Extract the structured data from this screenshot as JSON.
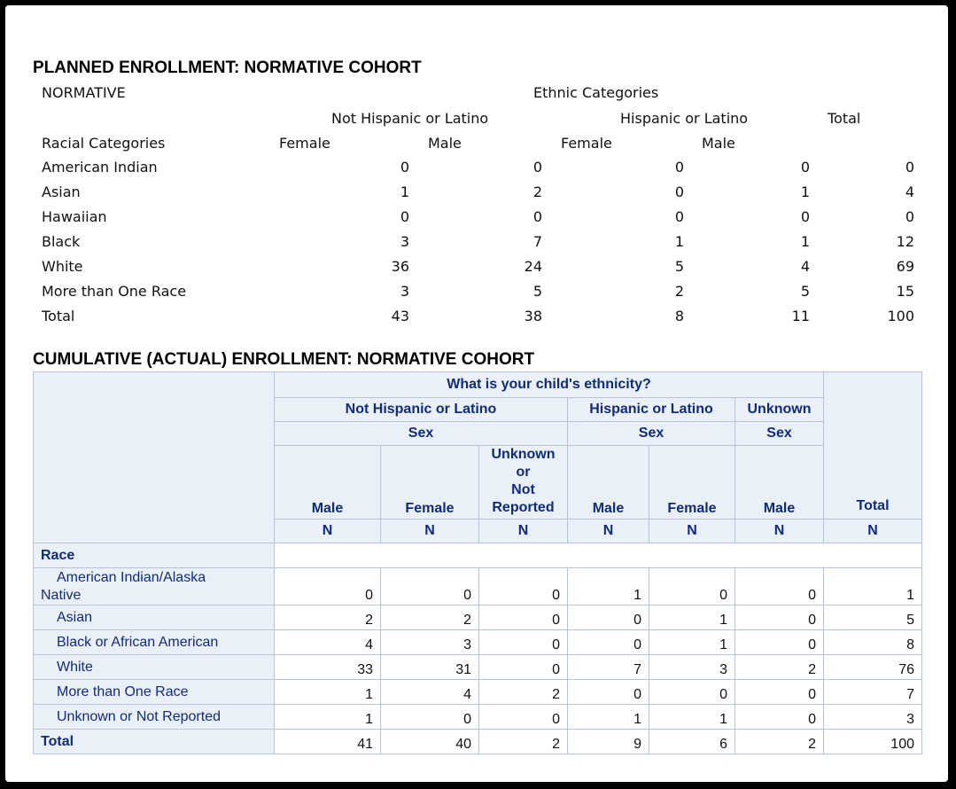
{
  "planned": {
    "title": "PLANNED ENROLLMENT: NORMATIVE COHORT",
    "label_normative": "NORMATIVE",
    "label_ethnic": "Ethnic Categories",
    "label_not_hispanic": "Not Hispanic or Latino",
    "label_hispanic": "Hispanic or Latino",
    "label_total": "Total",
    "label_racial": "Racial Categories",
    "label_female_1": "Female",
    "label_male_1": "Male",
    "label_female_2": "Female",
    "label_male_2": "Male",
    "rows": [
      {
        "label": "American Indian",
        "v": [
          "0",
          "0",
          "0",
          "0",
          "0"
        ]
      },
      {
        "label": "Asian",
        "v": [
          "1",
          "2",
          "0",
          "1",
          "4"
        ]
      },
      {
        "label": "Hawaiian",
        "v": [
          "0",
          "0",
          "0",
          "0",
          "0"
        ]
      },
      {
        "label": "Black",
        "v": [
          "3",
          "7",
          "1",
          "1",
          "12"
        ]
      },
      {
        "label": "White",
        "v": [
          "36",
          "24",
          "5",
          "4",
          "69"
        ]
      },
      {
        "label": "More than One Race",
        "v": [
          "3",
          "5",
          "2",
          "5",
          "15"
        ]
      },
      {
        "label": "Total",
        "v": [
          "43",
          "38",
          "8",
          "11",
          "100"
        ]
      }
    ]
  },
  "actual": {
    "title": "CUMULATIVE (ACTUAL) ENROLLMENT: NORMATIVE COHORT",
    "question": "What is your child's ethnicity?",
    "not_hispanic": "Not Hispanic or Latino",
    "hispanic": "Hispanic or Latino",
    "unknown": "Unknown",
    "sex": "Sex",
    "male": "Male",
    "female": "Female",
    "unknown_sex_l1": "Unknown",
    "unknown_sex_l2": "or",
    "unknown_sex_l3": "Not",
    "unknown_sex_l4": "Reported",
    "total": "Total",
    "n": "N",
    "race": "Race",
    "rows": [
      {
        "label_l1": "American Indian/Alaska",
        "label_l2": "Native",
        "v": [
          "0",
          "0",
          "0",
          "1",
          "0",
          "0",
          "1"
        ]
      },
      {
        "label": "Asian",
        "v": [
          "2",
          "2",
          "0",
          "0",
          "1",
          "0",
          "5"
        ]
      },
      {
        "label": "Black or African American",
        "v": [
          "4",
          "3",
          "0",
          "0",
          "1",
          "0",
          "8"
        ]
      },
      {
        "label": "White",
        "v": [
          "33",
          "31",
          "0",
          "7",
          "3",
          "2",
          "76"
        ]
      },
      {
        "label": "More than One Race",
        "v": [
          "1",
          "4",
          "2",
          "0",
          "0",
          "0",
          "7"
        ]
      },
      {
        "label": "Unknown or Not Reported",
        "v": [
          "1",
          "0",
          "0",
          "1",
          "1",
          "0",
          "3"
        ]
      },
      {
        "label": "Total",
        "v": [
          "41",
          "40",
          "2",
          "9",
          "6",
          "2",
          "100"
        ]
      }
    ]
  }
}
